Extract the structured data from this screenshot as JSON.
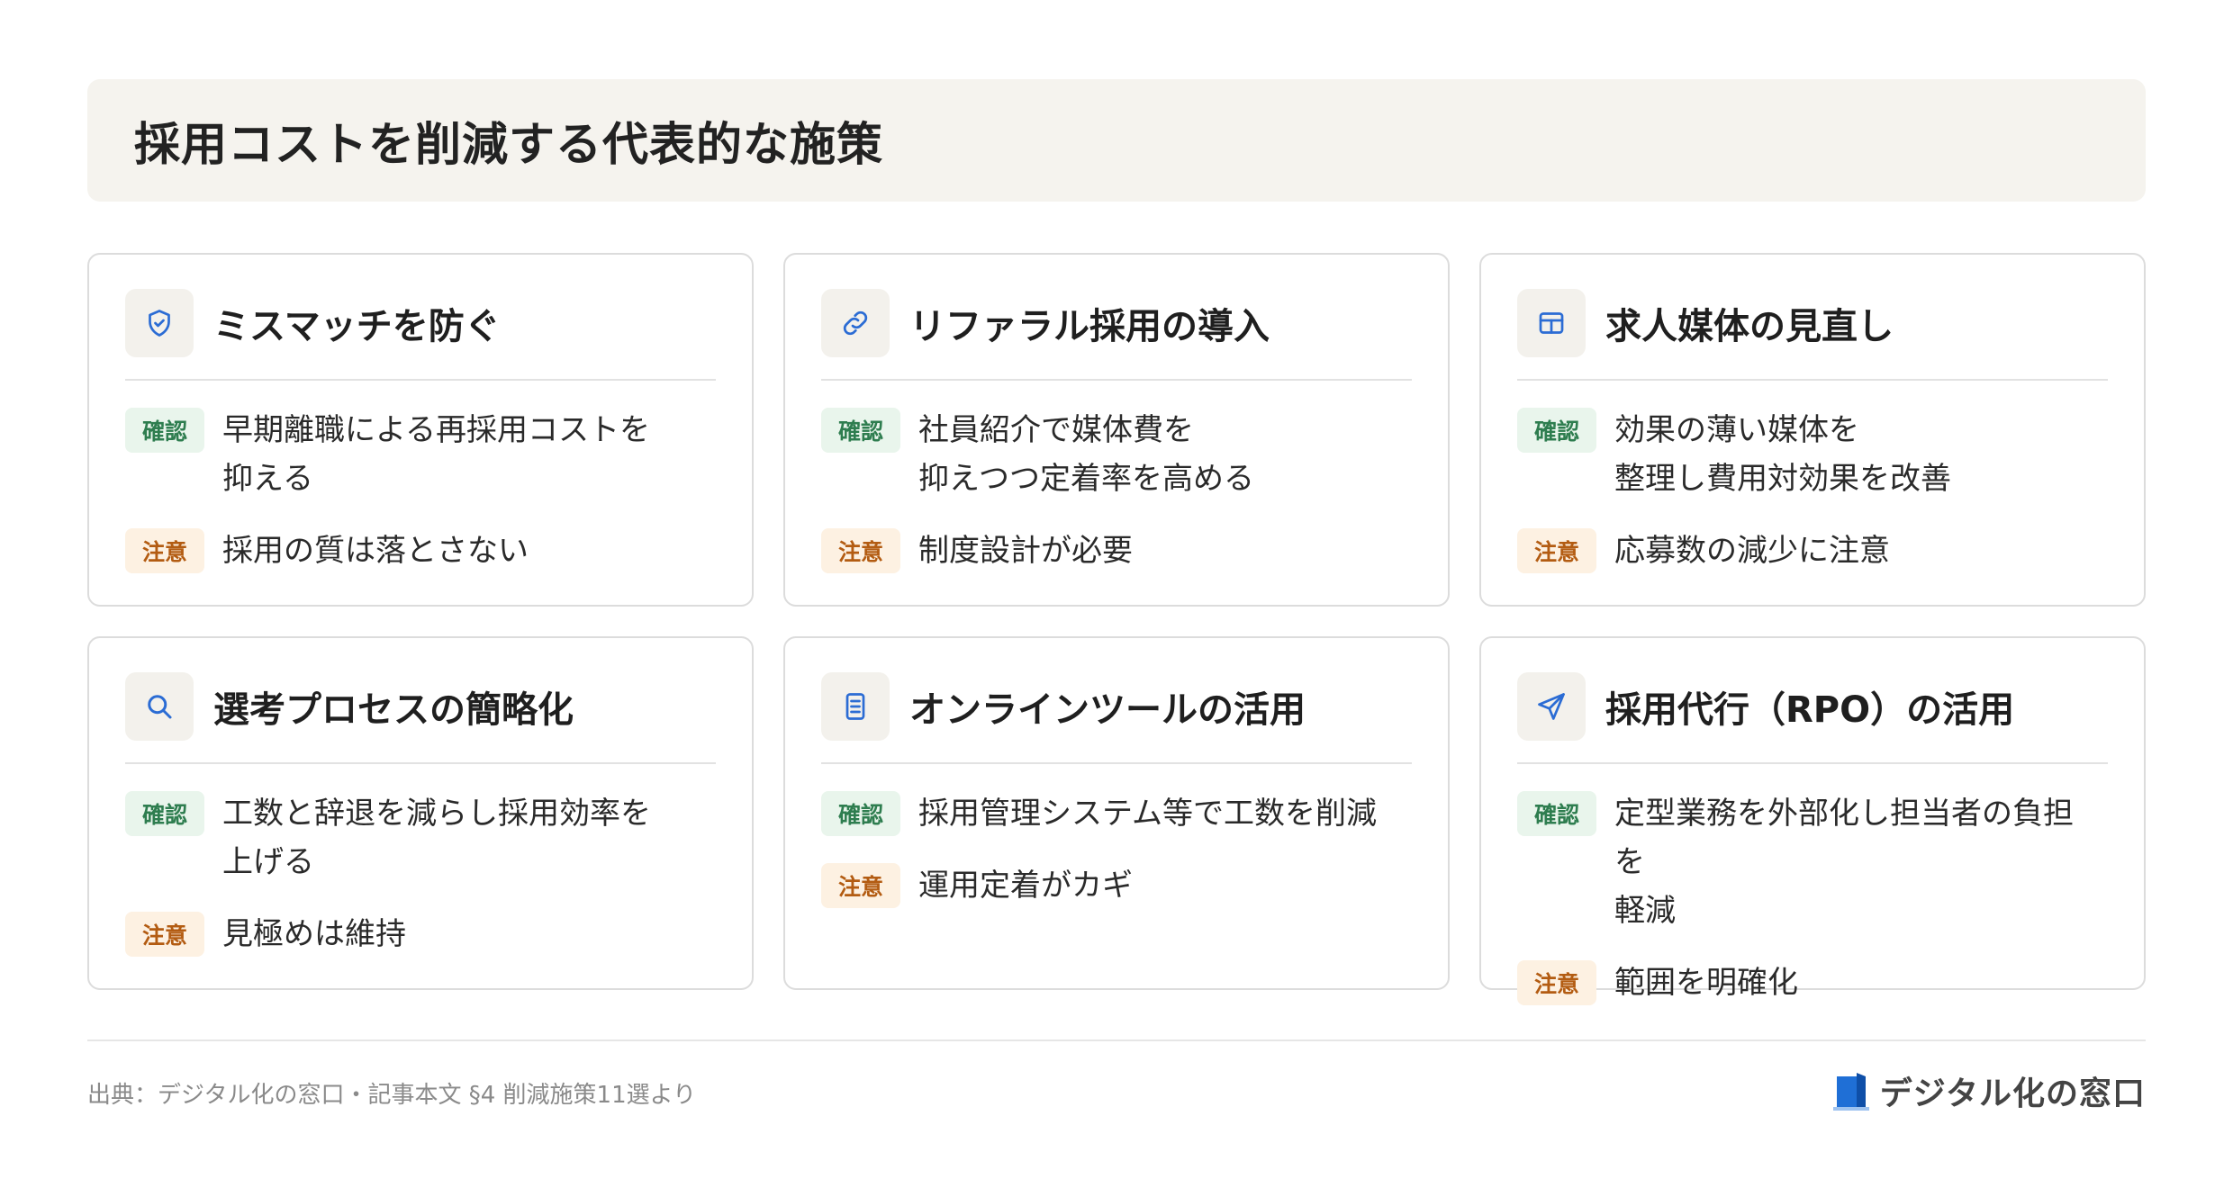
{
  "title": "採用コストを削減する代表的な施策",
  "badges": {
    "check": "確認",
    "warn": "注意"
  },
  "colors": {
    "accent": "#2b6cd4",
    "check": "#2e7d4f",
    "warn": "#b35c12"
  },
  "cards": [
    {
      "icon": "shield-check-icon",
      "title": "ミスマッチを防ぐ",
      "check": "早期離職による再採用コストを\n抑える",
      "warn": "採用の質は落とさない"
    },
    {
      "icon": "link-icon",
      "title": "リファラル採用の導入",
      "check": "社員紹介で媒体費を\n抑えつつ定着率を高める",
      "warn": "制度設計が必要"
    },
    {
      "icon": "layout-grid-icon",
      "title": "求人媒体の見直し",
      "check": "効果の薄い媒体を\n整理し費用対効果を改善",
      "warn": "応募数の減少に注意"
    },
    {
      "icon": "search-icon",
      "title": "選考プロセスの簡略化",
      "check": "工数と辞退を減らし採用効率を\n上げる",
      "warn": "見極めは維持"
    },
    {
      "icon": "document-icon",
      "title": "オンラインツールの活用",
      "check": "採用管理システム等で工数を削減",
      "warn": "運用定着がカギ"
    },
    {
      "icon": "send-icon",
      "title": "採用代行（RPO）の活用",
      "check": "定型業務を外部化し担当者の負担を\n軽減",
      "warn": "範囲を明確化"
    }
  ],
  "footer": {
    "source": "出典：デジタル化の窓口・記事本文 §4 削減施策11選より",
    "logo_text": "デジタル化の窓口"
  }
}
